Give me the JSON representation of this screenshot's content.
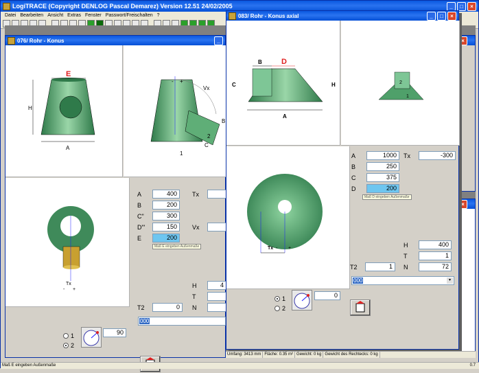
{
  "app": {
    "title": "LogiTRACE  (Copyright DENLOG Pascal Demarez)  Version 12.51  24/02/2005"
  },
  "menu": [
    "Datei",
    "Bearbeiten",
    "Ansicht",
    "Extras",
    "Fenster",
    "Passwort/Freischalten",
    "?"
  ],
  "window1": {
    "title": "076/ Rohr - Konus",
    "fields": [
      {
        "label": "A",
        "value": "400"
      },
      {
        "label": "B",
        "value": "200"
      },
      {
        "label": "C\"",
        "value": "300"
      },
      {
        "label": "D\"'",
        "value": "150"
      },
      {
        "label": "E",
        "value": "200"
      }
    ],
    "tx_label": "Tx",
    "vx_label": "Vx",
    "tooltip": "Maß E eingeben Außenmaße",
    "h_label": "H",
    "h_value": "4",
    "t_label": "T",
    "n_label": "N",
    "t2_label": "T2",
    "t2_value": "0",
    "combo_value": "000",
    "radio1": "1",
    "radio2": "2",
    "angle_value": "90",
    "fig": {
      "E": "E",
      "H": "H",
      "A": "A",
      "Vx": "Vx",
      "minus": "-",
      "plus": "+",
      "B": "B",
      "C": "C",
      "n1": "1",
      "n2": "2",
      "Tx": "Tx",
      "txminus": "-",
      "txplus": "+"
    }
  },
  "window2": {
    "title": "083/ Rohr - Konus axial",
    "fields": [
      {
        "label": "A",
        "value": "1000"
      },
      {
        "label": "B",
        "value": "250"
      },
      {
        "label": "C",
        "value": "375"
      },
      {
        "label": "D",
        "value": "200"
      }
    ],
    "tx_label": "Tx",
    "tx_value": "-300",
    "tooltip": "Maß D eingeben Außenmaße",
    "h_label": "H",
    "h_value": "400",
    "t_label": "T",
    "t_value": "1",
    "n_label": "N",
    "n_value": "72",
    "t2_label": "T2",
    "t2_value": "1",
    "combo_value": "000",
    "radio1": "1",
    "radio2": "2",
    "angle_value": "0",
    "fig": {
      "B": "B",
      "D": "D",
      "C": "C",
      "H": "H",
      "A": "A",
      "n2": "2",
      "n1": "1",
      "Tx": "Tx",
      "minus": "-",
      "plus": "+"
    }
  },
  "inner_status": [
    "Umfang: 3413 mm",
    "Fläche: 0.35 m²",
    "Gewicht: 0 kg",
    "Gewicht des Rechtecks: 0 kg"
  ],
  "status": {
    "text": "Maß E eingeben Außenmaße",
    "right": "0.7"
  },
  "colors": {
    "titlebar": "#0a58e0",
    "accent_red": "#e02020",
    "cone_green": "#4fa06a",
    "highlight": "#6ec6f0"
  }
}
